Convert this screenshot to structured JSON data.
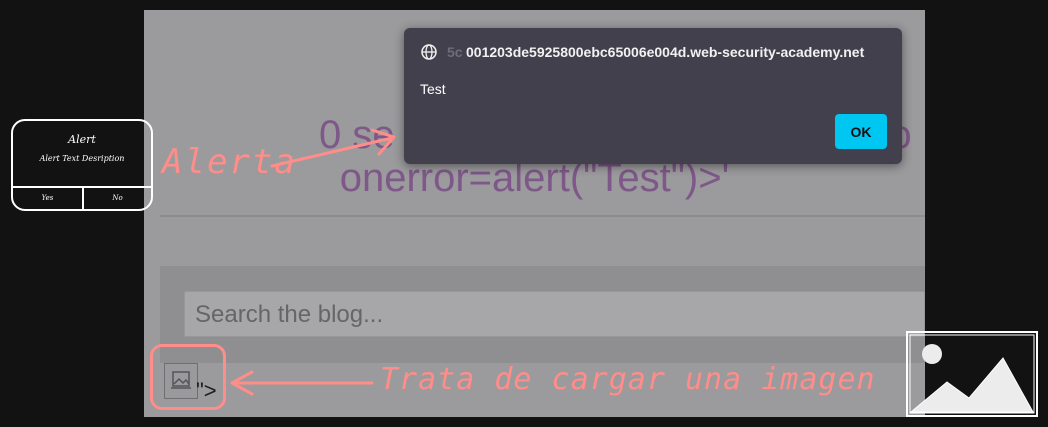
{
  "page": {
    "heading_line1": "0 se",
    "heading_line1_end": "ro",
    "heading_line2": "onerror=alert(\"Test\")>'",
    "search_placeholder": "Search the blog...",
    "tail_text": "\">"
  },
  "dialog": {
    "origin_faded": "5c",
    "origin": "001203de5925800ebc65006e004d.web-security-academy.net",
    "message": "Test",
    "ok_label": "OK",
    "globe_icon": "globe-icon"
  },
  "annotations": {
    "alerta": "Alerta",
    "trata": "Trata de cargar una imagen",
    "color": "#ff8d89"
  },
  "alert_sketch": {
    "title": "Alert",
    "description": "Alert Text Desription",
    "yes": "Yes",
    "no": "No"
  },
  "colors": {
    "dialog_bg": "#43404d",
    "ok_button": "#00c7f2",
    "heading": "#7e5888"
  }
}
